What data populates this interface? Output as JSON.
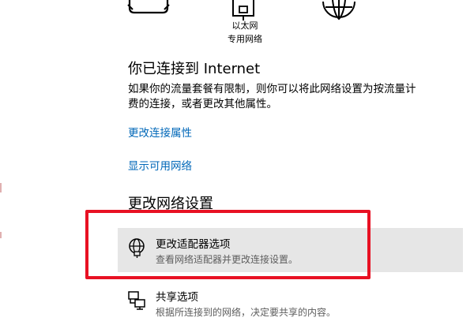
{
  "network_icons": {
    "icons": [
      "dialup-icon",
      "ethernet-icon",
      "globe-icon"
    ],
    "ethernet_label": "以太网",
    "ethernet_sublabel": "专用网络"
  },
  "status": {
    "title": "你已连接到 Internet",
    "description_line1": "如果你的流量套餐有限制，则你可以将此网络设置为按流量计",
    "description_line2": "费的连接，或者更改其他属性。"
  },
  "links": {
    "change_connection_properties": "更改连接属性",
    "show_available_networks": "显示可用网络"
  },
  "advanced": {
    "title": "更改网络设置",
    "options": [
      {
        "icon": "adapter-globe-icon",
        "title": "更改适配器选项",
        "desc": "查看网络适配器并更改连接设置。",
        "highlighted": true
      },
      {
        "icon": "sharing-icon",
        "title": "共享选项",
        "desc": "根据所连接到的网络，决定要共享的内容。",
        "highlighted": false
      }
    ]
  },
  "colors": {
    "link": "#0067b8",
    "highlight_bg": "#e6e6e6",
    "annotation_box": "#e81123"
  }
}
